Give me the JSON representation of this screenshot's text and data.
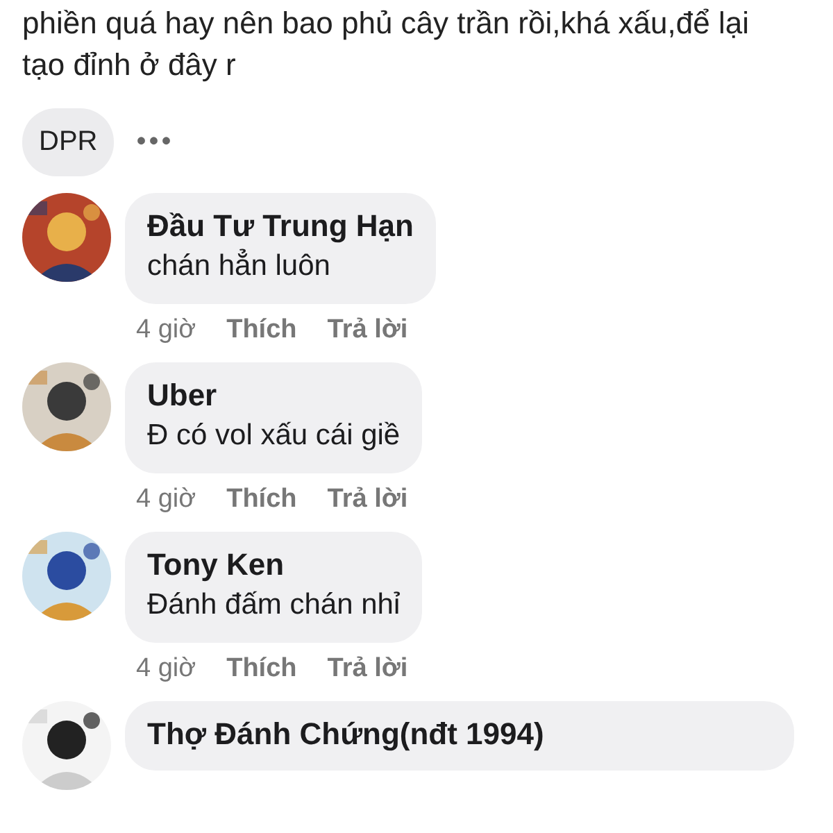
{
  "post_text": "phiền quá hay nên bao phủ cây trần rồi,khá xấu,để lại tạo đỉnh ở đây r",
  "reaction_chip": "DPR",
  "more": "•••",
  "comments": [
    {
      "name": "Đầu Tư Trung Hạn",
      "text": "chán hẳn luôn",
      "time": "4 giờ",
      "like": "Thích",
      "reply": "Trả lời"
    },
    {
      "name": "Uber",
      "text": "Đ có vol xấu cái giề",
      "time": "4 giờ",
      "like": "Thích",
      "reply": "Trả lời"
    },
    {
      "name": "Tony Ken",
      "text": "Đánh đấm chán nhỉ",
      "time": "4 giờ",
      "like": "Thích",
      "reply": "Trả lời"
    },
    {
      "name": "Thợ Đánh Chứng(nđt 1994)"
    }
  ]
}
